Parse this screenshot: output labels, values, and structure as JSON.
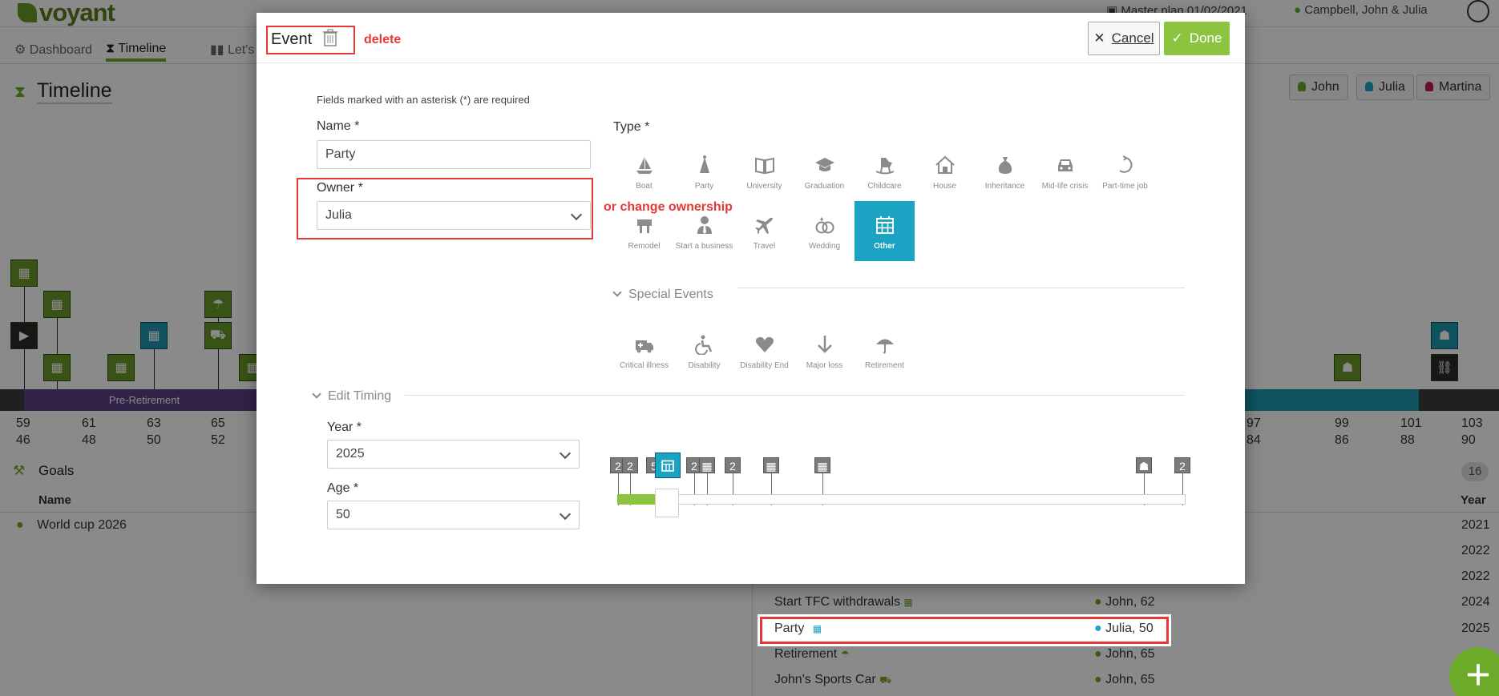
{
  "app": {
    "brand": "voyant",
    "plan": "Master plan 01/02/2021",
    "client": "Campbell, John & Julia"
  },
  "nav": {
    "dashboard": "Dashboard",
    "timeline": "Timeline",
    "lets": "Let's"
  },
  "timeline": {
    "title": "Timeline",
    "people": [
      "John",
      "Julia",
      "Martina"
    ],
    "band_label": "Pre-Retirement",
    "ages_row1": [
      "59",
      "61",
      "63",
      "65"
    ],
    "ages_row2": [
      "46",
      "48",
      "50",
      "52"
    ],
    "ages_right_row1": [
      "97",
      "99",
      "101",
      "103"
    ],
    "ages_right_row2": [
      "84",
      "86",
      "88",
      "90"
    ]
  },
  "goals": {
    "title": "Goals",
    "count": "16",
    "col_name": "Name",
    "col_year": "Year",
    "left_rows": [
      {
        "name": "World cup 2026"
      }
    ],
    "years": [
      "2021",
      "2022",
      "2022",
      "2024",
      "2025"
    ],
    "rows": [
      {
        "name": "Start TFC withdrawals",
        "owner": "John, 62",
        "year": "2024"
      },
      {
        "name": "Party",
        "owner": "Julia, 50",
        "year": "2025"
      },
      {
        "name": "Retirement",
        "owner": "John, 65",
        "year": ""
      },
      {
        "name": "John's Sports Car",
        "owner": "John, 65",
        "year": ""
      }
    ]
  },
  "modal": {
    "title": "Event",
    "cancel": "Cancel",
    "done": "Done",
    "required_note": "Fields marked with an asterisk (*) are required",
    "name_label": "Name *",
    "name_value": "Party",
    "owner_label": "Owner *",
    "owner_value": "Julia",
    "type_label": "Type *",
    "types": [
      {
        "label": "Boat",
        "icon": "boat-icon"
      },
      {
        "label": "Party",
        "icon": "party-hat-icon"
      },
      {
        "label": "University",
        "icon": "book-icon"
      },
      {
        "label": "Graduation",
        "icon": "graduation-cap-icon"
      },
      {
        "label": "Childcare",
        "icon": "rocking-horse-icon"
      },
      {
        "label": "House",
        "icon": "house-icon"
      },
      {
        "label": "Inheritance",
        "icon": "money-bag-icon"
      },
      {
        "label": "Mid-life crisis",
        "icon": "car-icon"
      },
      {
        "label": "Part-time job",
        "icon": "part-time-icon"
      },
      {
        "label": "Remodel",
        "icon": "remodel-icon"
      },
      {
        "label": "Start a business",
        "icon": "businessman-icon"
      },
      {
        "label": "Travel",
        "icon": "plane-icon"
      },
      {
        "label": "Wedding",
        "icon": "rings-icon"
      },
      {
        "label": "Other",
        "icon": "calendar-icon",
        "selected": true
      }
    ],
    "special_events_label": "Special Events",
    "special_events": [
      {
        "label": "Critical illness",
        "icon": "ambulance-icon"
      },
      {
        "label": "Disability",
        "icon": "wheelchair-icon"
      },
      {
        "label": "Disability End",
        "icon": "heart-icon"
      },
      {
        "label": "Major loss",
        "icon": "arrow-down-icon"
      },
      {
        "label": "Retirement",
        "icon": "umbrella-icon"
      }
    ],
    "edit_timing_label": "Edit Timing",
    "year_label": "Year *",
    "year_value": "2025",
    "age_label": "Age *",
    "age_value": "50",
    "mini_counts": [
      "2",
      "2",
      "5",
      "2",
      "2",
      "2"
    ]
  },
  "annotations": {
    "delete": "delete",
    "owner": "or change ownership"
  },
  "colors": {
    "accent_green": "#8cc43f",
    "teal": "#1aa3c2",
    "annotation_red": "#e53935",
    "purple": "#5b3f84"
  }
}
